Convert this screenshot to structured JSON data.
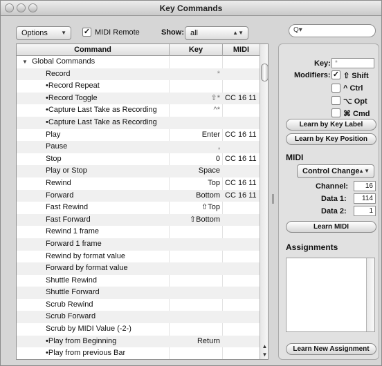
{
  "window": {
    "title": "Key Commands"
  },
  "toolbar": {
    "options_label": "Options",
    "midi_remote_label": "MIDI Remote",
    "midi_remote_checked": "✓",
    "show_label": "Show:",
    "show_value": "all",
    "search_icon": "Q▾"
  },
  "table": {
    "headers": {
      "command": "Command",
      "key": "Key",
      "midi": "MIDI"
    },
    "group": "Global Commands",
    "rows": [
      {
        "command": "Record",
        "key": "*",
        "midi": ""
      },
      {
        "command": "•Record Repeat",
        "key": "",
        "midi": ""
      },
      {
        "command": "•Record Toggle",
        "key": "⇧*",
        "midi": "CC 16 11"
      },
      {
        "command": "•Capture Last Take as Recording",
        "key": "^*",
        "midi": ""
      },
      {
        "command": "•Capture Last Take as Recording",
        "key": "",
        "midi": ""
      },
      {
        "command": "Play",
        "key": "Enter",
        "midi": "CC 16 11"
      },
      {
        "command": "Pause",
        "key": ",",
        "midi": ""
      },
      {
        "command": "Stop",
        "key": "0",
        "midi": "CC 16 11"
      },
      {
        "command": "Play or Stop",
        "key": "Space",
        "midi": ""
      },
      {
        "command": "Rewind",
        "key": "Top",
        "midi": "CC 16 11"
      },
      {
        "command": "Forward",
        "key": "Bottom",
        "midi": "CC 16 11"
      },
      {
        "command": "Fast Rewind",
        "key": "⇧Top",
        "midi": ""
      },
      {
        "command": "Fast Forward",
        "key": "⇧Bottom",
        "midi": ""
      },
      {
        "command": "Rewind 1 frame",
        "key": "",
        "midi": ""
      },
      {
        "command": "Forward 1 frame",
        "key": "",
        "midi": ""
      },
      {
        "command": "Rewind by format value",
        "key": "",
        "midi": ""
      },
      {
        "command": "Forward by format value",
        "key": "",
        "midi": ""
      },
      {
        "command": "Shuttle Rewind",
        "key": "",
        "midi": ""
      },
      {
        "command": "Shuttle Forward",
        "key": "",
        "midi": ""
      },
      {
        "command": "Scrub Rewind",
        "key": "",
        "midi": ""
      },
      {
        "command": "Scrub Forward",
        "key": "",
        "midi": ""
      },
      {
        "command": "Scrub by MIDI Value (-2-)",
        "key": "",
        "midi": ""
      },
      {
        "command": "•Play from Beginning",
        "key": "Return",
        "midi": ""
      },
      {
        "command": "•Play from previous Bar",
        "key": "",
        "midi": ""
      }
    ]
  },
  "panel": {
    "key_label": "Key:",
    "key_value": "*",
    "modifiers_label": "Modifiers:",
    "shift_label": "⇧ Shift",
    "shift_checked": "✓",
    "ctrl_label": "^ Ctrl",
    "opt_label": "⌥ Opt",
    "cmd_label": "⌘ Cmd",
    "learn_key_label": "Learn by Key Label",
    "learn_key_position": "Learn by Key Position",
    "midi_heading": "MIDI",
    "midi_type": "Control Change",
    "channel_label": "Channel:",
    "channel_value": "16",
    "data1_label": "Data 1:",
    "data1_value": "114",
    "data2_label": "Data 2:",
    "data2_value": "1",
    "learn_midi": "Learn MIDI",
    "assignments_heading": "Assignments",
    "learn_new_assignment": "Learn New Assignment"
  }
}
